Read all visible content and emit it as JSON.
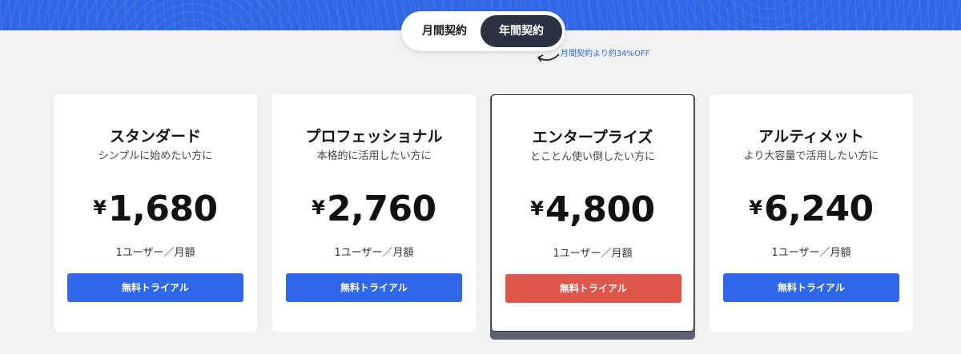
{
  "billing_toggle": {
    "monthly_label": "月間契約",
    "yearly_label": "年間契約",
    "selected": "年間契約",
    "discount_note": "月間契約より約34%OFF"
  },
  "plans": [
    {
      "name": "スタンダード",
      "description": "シンプルに始めたい方に",
      "currency": "¥",
      "price": "1,680",
      "unit": "1ユーザー／月額",
      "button_label": "無料トライアル",
      "button_color": "#2f67e6"
    },
    {
      "name": "プロフェッショナル",
      "description": "本格的に活用したい方に",
      "currency": "¥",
      "price": "2,760",
      "unit": "1ユーザー／月額",
      "button_label": "無料トライアル",
      "button_color": "#2f67e6"
    },
    {
      "name": "エンタープライズ",
      "description": "とことん使い倒したい方に",
      "currency": "¥",
      "price": "4,800",
      "unit": "1ユーザー／月額",
      "button_label": "無料トライアル",
      "button_color": "#e0554a"
    },
    {
      "name": "アルティメット",
      "description": "より大容量で活用したい方に",
      "currency": "¥",
      "price": "6,240",
      "unit": "1ユーザー／月額",
      "button_label": "無料トライアル",
      "button_color": "#2f67e6"
    }
  ],
  "colors": {
    "brand_blue": "#2f67e6",
    "accent_red": "#e0554a",
    "dark": "#2b3342",
    "background": "#f2f2f2"
  },
  "icons": {
    "discount_pointer": "curved-arrow-icon"
  }
}
